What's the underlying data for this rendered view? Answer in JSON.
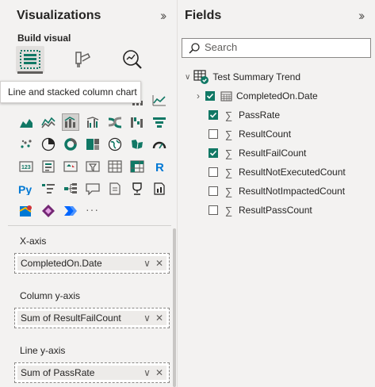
{
  "visualizations": {
    "title": "Visualizations",
    "build_visual": "Build visual",
    "tooltip": "Line and stacked column chart",
    "more": "···"
  },
  "wells": {
    "xaxis": {
      "label": "X-axis",
      "value": "CompletedOn.Date"
    },
    "column_y": {
      "label": "Column y-axis",
      "value": "Sum of ResultFailCount"
    },
    "line_y": {
      "label": "Line y-axis",
      "value": "Sum of PassRate"
    }
  },
  "fields": {
    "title": "Fields",
    "search_placeholder": "Search",
    "table_name": "Test Summary Trend",
    "items": [
      {
        "label": "CompletedOn.Date",
        "checked": true
      },
      {
        "label": "PassRate",
        "checked": true
      },
      {
        "label": "ResultCount",
        "checked": false
      },
      {
        "label": "ResultFailCount",
        "checked": true
      },
      {
        "label": "ResultNotExecutedCount",
        "checked": false
      },
      {
        "label": "ResultNotImpactedCount",
        "checked": false
      },
      {
        "label": "ResultPassCount",
        "checked": false
      }
    ]
  },
  "colors": {
    "accent_teal": "#117865",
    "pane_bg": "#f3f2f1"
  },
  "icons": {
    "visual_grid": [
      "stacked-bar-chart-icon",
      "stacked-column-chart-icon",
      "clustered-bar-chart-icon",
      "clustered-column-chart-icon",
      "100-stacked-bar-chart-icon",
      "line-chart-icon",
      "area-chart-icon",
      "stacked-area-chart-icon",
      "line-and-stacked-column-chart-icon",
      "line-and-clustered-column-chart-icon",
      "ribbon-chart-icon",
      "waterfall-chart-icon",
      "funnel-chart-icon",
      "scatter-chart-icon",
      "pie-chart-icon",
      "donut-chart-icon",
      "treemap-icon",
      "map-icon",
      "filled-map-icon",
      "gauge-icon",
      "card-icon",
      "multi-row-card-icon",
      "kpi-icon",
      "slicer-icon",
      "table-icon",
      "matrix-icon",
      "r-visual-icon",
      "python-visual-icon",
      "key-influencers-icon",
      "decomposition-tree-icon",
      "qa-icon",
      "smart-narrative-icon",
      "metrics-icon",
      "paginated-report-icon",
      "azure-map-icon",
      "power-apps-icon",
      "power-automate-icon"
    ]
  }
}
